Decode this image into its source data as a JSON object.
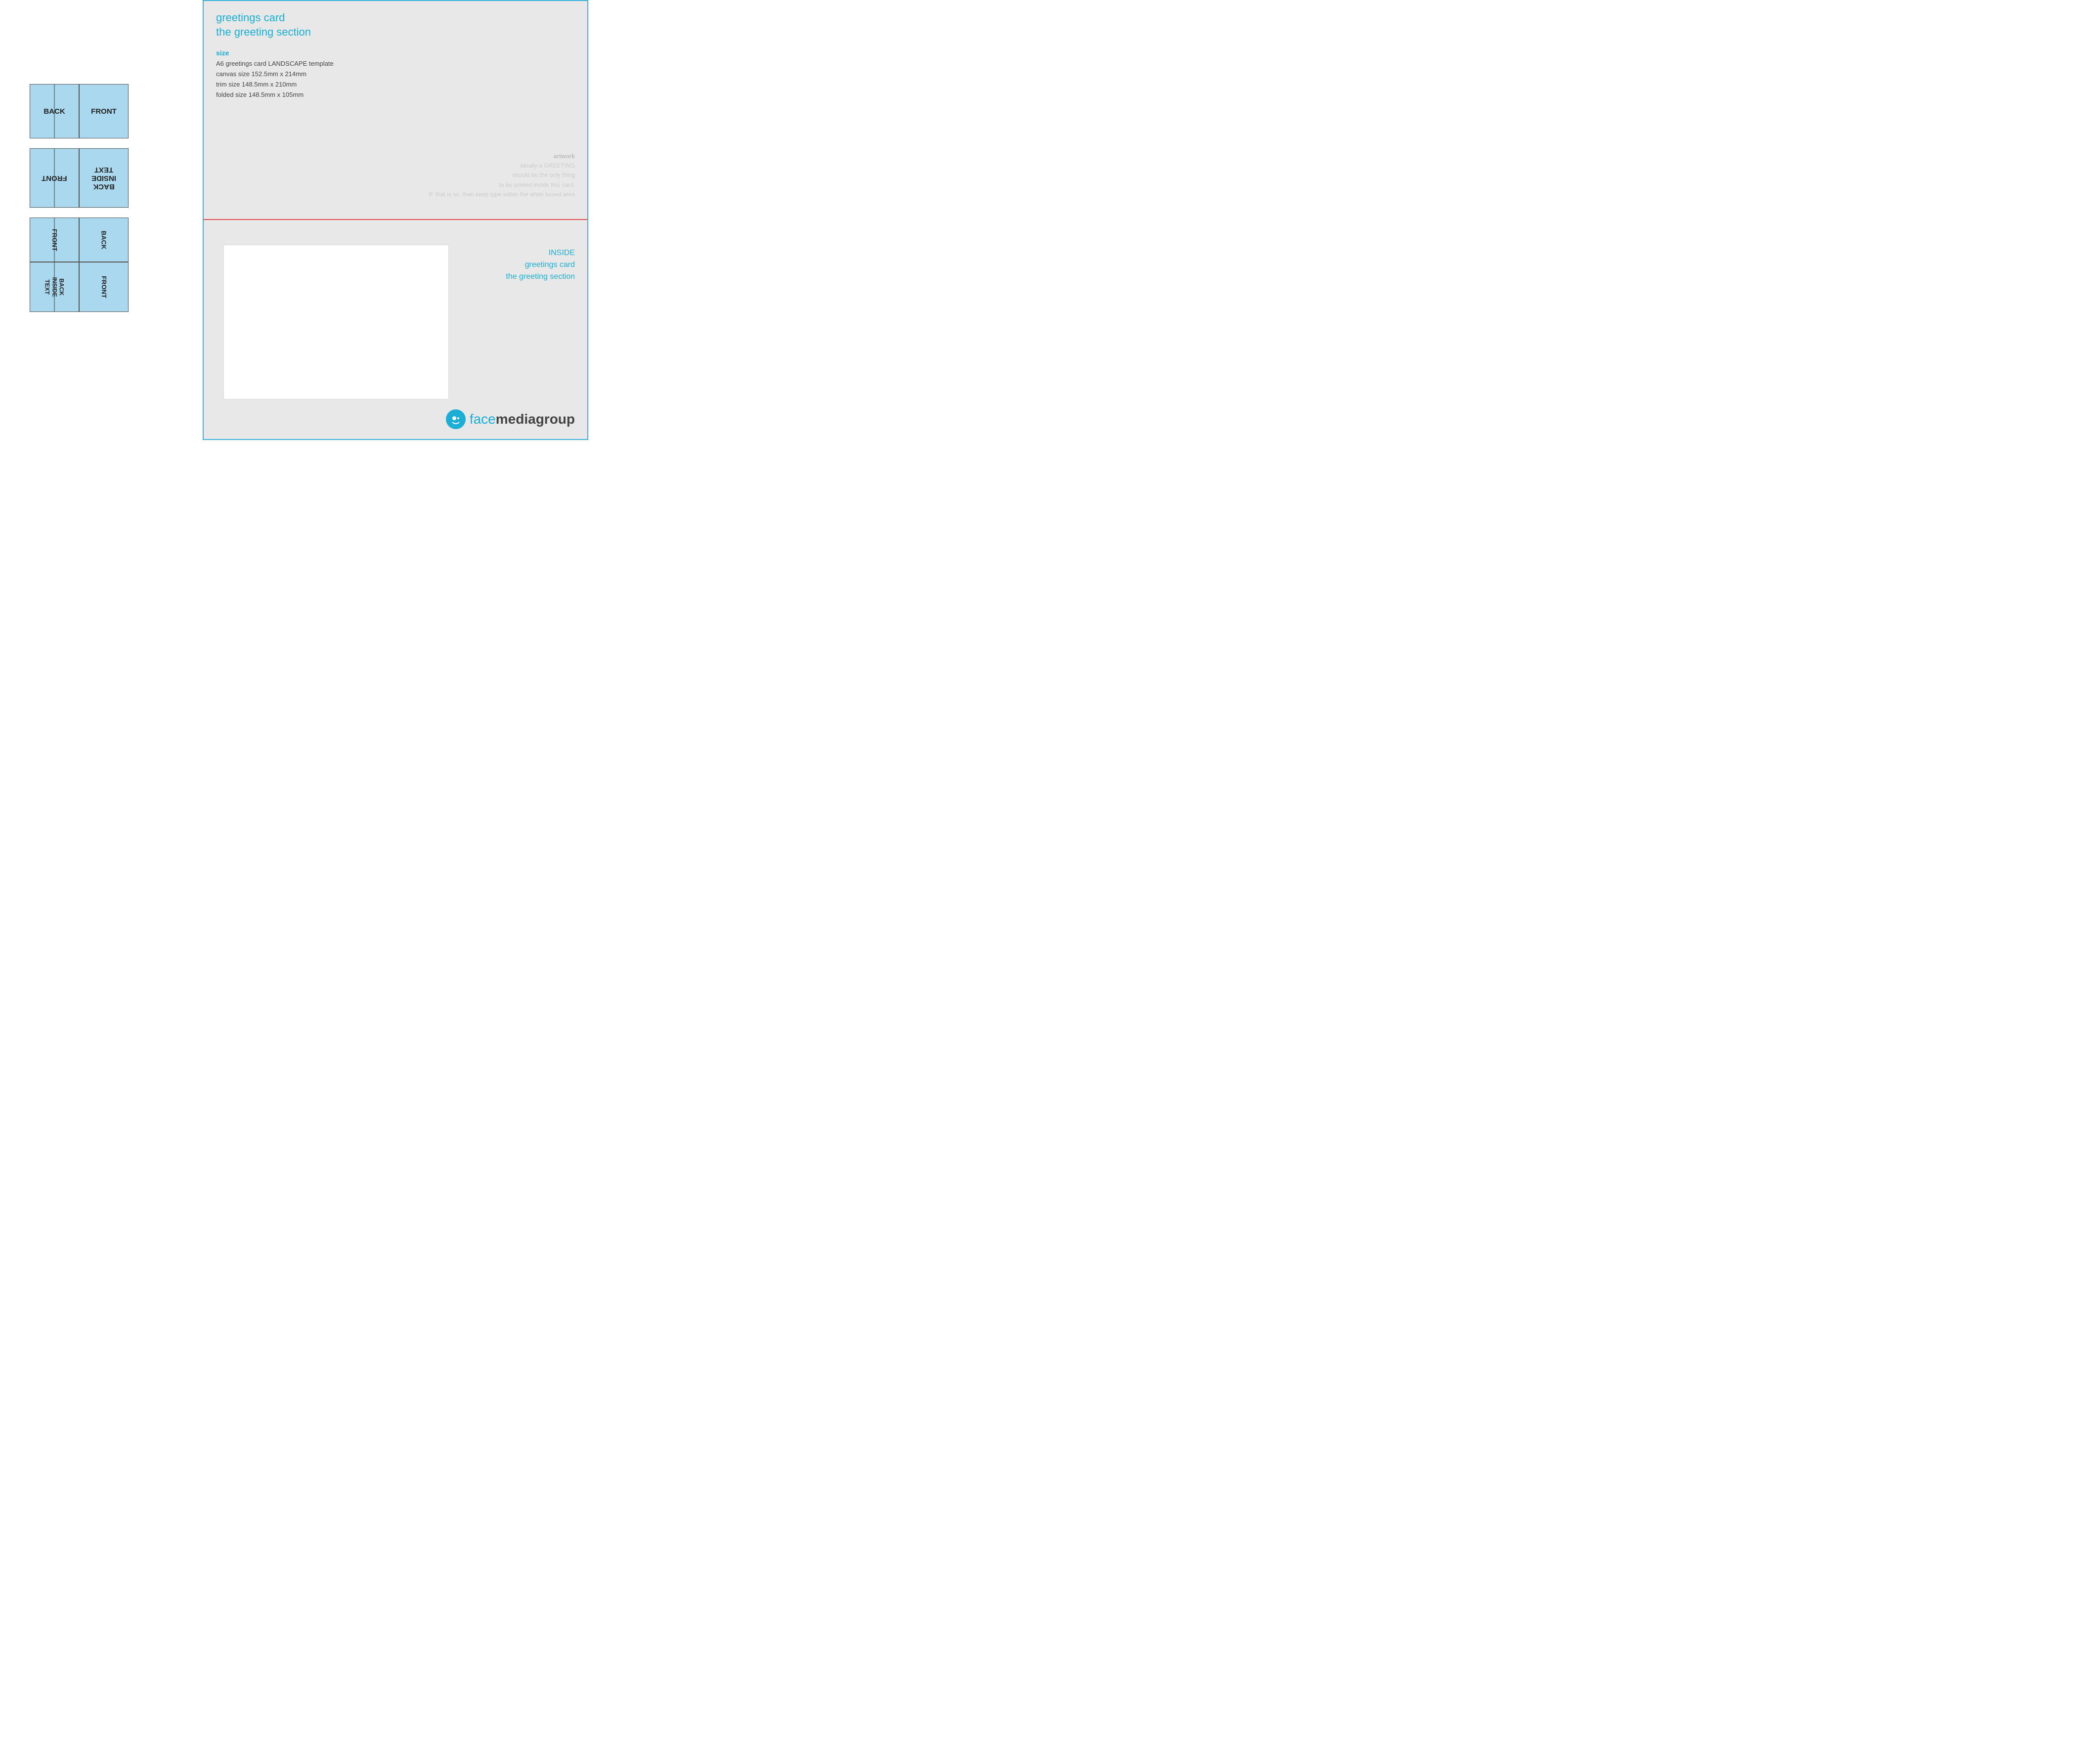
{
  "title": {
    "line1": "greetings card",
    "line2": "the greeting section"
  },
  "size_label": "size",
  "size_details": [
    "A6 greetings card LANDSCAPE template",
    "canvas size 152.5mm x 214mm",
    "trim size 148.5mm x 210mm",
    "folded size 148.5mm x 105mm"
  ],
  "artwork_label": "artwork",
  "artwork_text": [
    "ideally a GREETING",
    "should be the only thing",
    "to be printed inside this card.",
    "IF that is so, then keep type within the white boxed area"
  ],
  "inside_label": "INSIDE",
  "inside_subtitle1": "greetings card",
  "inside_subtitle2": "the greeting section",
  "logo_text_face": "face",
  "logo_text_media": "mediagroup",
  "cards": {
    "group1": {
      "back": "BACK",
      "front": "FRONT"
    },
    "group2": {
      "front_r": "FRONT",
      "back_r": "BACK\nINSIDE\nTEXT"
    },
    "group3": {
      "front_r": "FRONT",
      "back_r": "BACK"
    },
    "group4": {
      "back_r": "BACK\nINSIDE\nTEXT",
      "front_r": "FRONT"
    }
  }
}
